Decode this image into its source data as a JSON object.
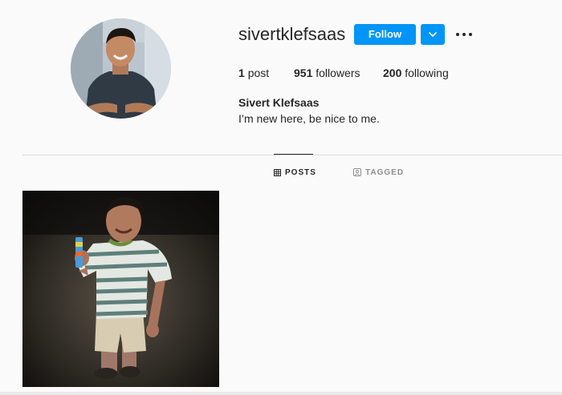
{
  "profile": {
    "username": "sivertklefsaas",
    "full_name": "Sivert Klefsaas",
    "bio": "I’m new here, be nice to me.",
    "avatar_icon": "profile-photo"
  },
  "actions": {
    "follow_label": "Follow",
    "dropdown_icon": "chevron-down-icon",
    "more_icon": "more-options-icon",
    "accent_color": "#0095f6"
  },
  "stats": {
    "posts_count": "1",
    "posts_label": "post",
    "followers_count": "951",
    "followers_label": "followers",
    "following_count": "200",
    "following_label": "following"
  },
  "tabs": [
    {
      "label": "POSTS",
      "icon": "grid-icon",
      "active": true
    },
    {
      "label": "TAGGED",
      "icon": "tagged-icon",
      "active": false
    }
  ],
  "posts": [
    {
      "thumbnail": "photo-of-child-in-striped-shirt"
    }
  ]
}
